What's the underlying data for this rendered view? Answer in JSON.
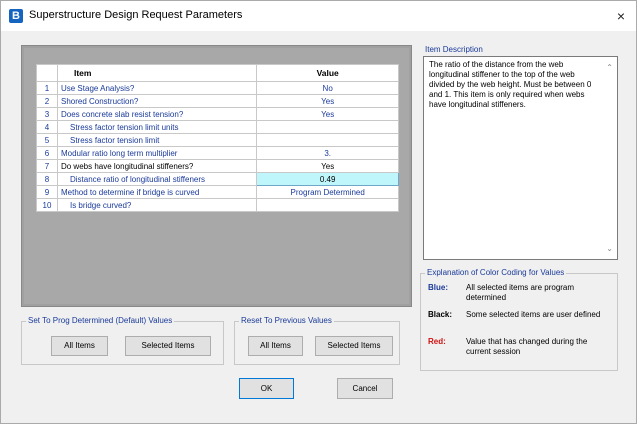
{
  "window": {
    "title": "Superstructure Design Request Parameters",
    "app_icon_letter": "B",
    "close_glyph": "×"
  },
  "grid": {
    "headers": {
      "item": "Item",
      "value": "Value"
    },
    "rows": [
      {
        "num": "1",
        "item": "Use Stage Analysis?",
        "value": "No"
      },
      {
        "num": "2",
        "item": "Shored Construction?",
        "value": "Yes"
      },
      {
        "num": "3",
        "item": "Does concrete slab resist tension?",
        "value": "Yes"
      },
      {
        "num": "4",
        "item": "Stress factor tension limit units",
        "value": ""
      },
      {
        "num": "5",
        "item": "Stress factor tension limit",
        "value": ""
      },
      {
        "num": "6",
        "item": "Modular ratio long term multiplier",
        "value": "3."
      },
      {
        "num": "7",
        "item": "Do webs have longitudinal stiffeners?",
        "value": "Yes"
      },
      {
        "num": "8",
        "item": "Distance ratio of longitudinal stiffeners",
        "value": "0.49"
      },
      {
        "num": "9",
        "item": "Method to determine if bridge is curved",
        "value": "Program Determined"
      },
      {
        "num": "10",
        "item": "Is bridge curved?",
        "value": ""
      }
    ]
  },
  "set_defaults": {
    "label": "Set To Prog Determined (Default) Values",
    "all_items": "All Items",
    "selected_items": "Selected Items"
  },
  "reset_previous": {
    "label": "Reset To Previous Values",
    "all_items": "All Items",
    "selected_items": "Selected Items"
  },
  "item_description": {
    "label": "Item Description",
    "text": "The ratio of the distance from the web longitudinal stiffener to the top of the web divided by the web height. Must be between 0 and 1. This item is only required when webs have longitudinal stiffeners."
  },
  "color_coding": {
    "label": "Explanation of Color Coding for Values",
    "entries": [
      {
        "key": "Blue:",
        "color": "#1a3a9a",
        "desc": "All selected items are program determined"
      },
      {
        "key": "Black:",
        "color": "#000000",
        "desc": "Some selected items are user defined"
      },
      {
        "key": "Red:",
        "color": "#d01010",
        "desc": "Value that has changed during the current session"
      }
    ]
  },
  "buttons": {
    "ok": "OK",
    "cancel": "Cancel"
  }
}
